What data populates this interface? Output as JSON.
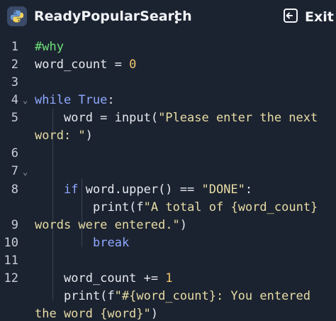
{
  "app": {
    "title": "ReadyPopularSearch",
    "icon": "python-logo-icon",
    "menu_icon": "kebab-menu-icon",
    "exit_label": "Exit",
    "exit_icon": "exit-icon"
  },
  "colors": {
    "background": "#1c2330",
    "keyword": "#8ea9ff",
    "string": "#e7dca5",
    "number": "#f0c76c",
    "comment": "#6de07a",
    "text": "#e6e9ef"
  },
  "editor": {
    "line_numbers": [
      "1",
      "2",
      "3",
      "4",
      "5",
      "6",
      "7",
      "8",
      "9",
      "10",
      "11",
      "12"
    ],
    "fold_markers": [
      "⌄",
      "⌄"
    ],
    "lines": {
      "l1": {
        "comment": "#why"
      },
      "l2": {
        "ident": "word_count = ",
        "num": "0"
      },
      "l4": {
        "kw": "while True",
        "rest": ":"
      },
      "l5": {
        "a": "word = input(",
        "str1": "\"Please enter the next",
        "str2": "word: \"",
        "b": ")"
      },
      "l7": {
        "kw": "if",
        "a": " word.upper() == ",
        "str": "\"DONE\"",
        "b": ":"
      },
      "l8": {
        "a": "print(f",
        "str1": "\"A total of {word_count}",
        "str2": "words were entered.\"",
        "b": ")"
      },
      "l9": {
        "kw": "break"
      },
      "l11": {
        "a": "word_count += ",
        "num": "1"
      },
      "l12": {
        "a": "print(f",
        "str1": "\"#{word_count}: You entered",
        "str2": "the word {word}\"",
        "b": ")"
      }
    }
  }
}
